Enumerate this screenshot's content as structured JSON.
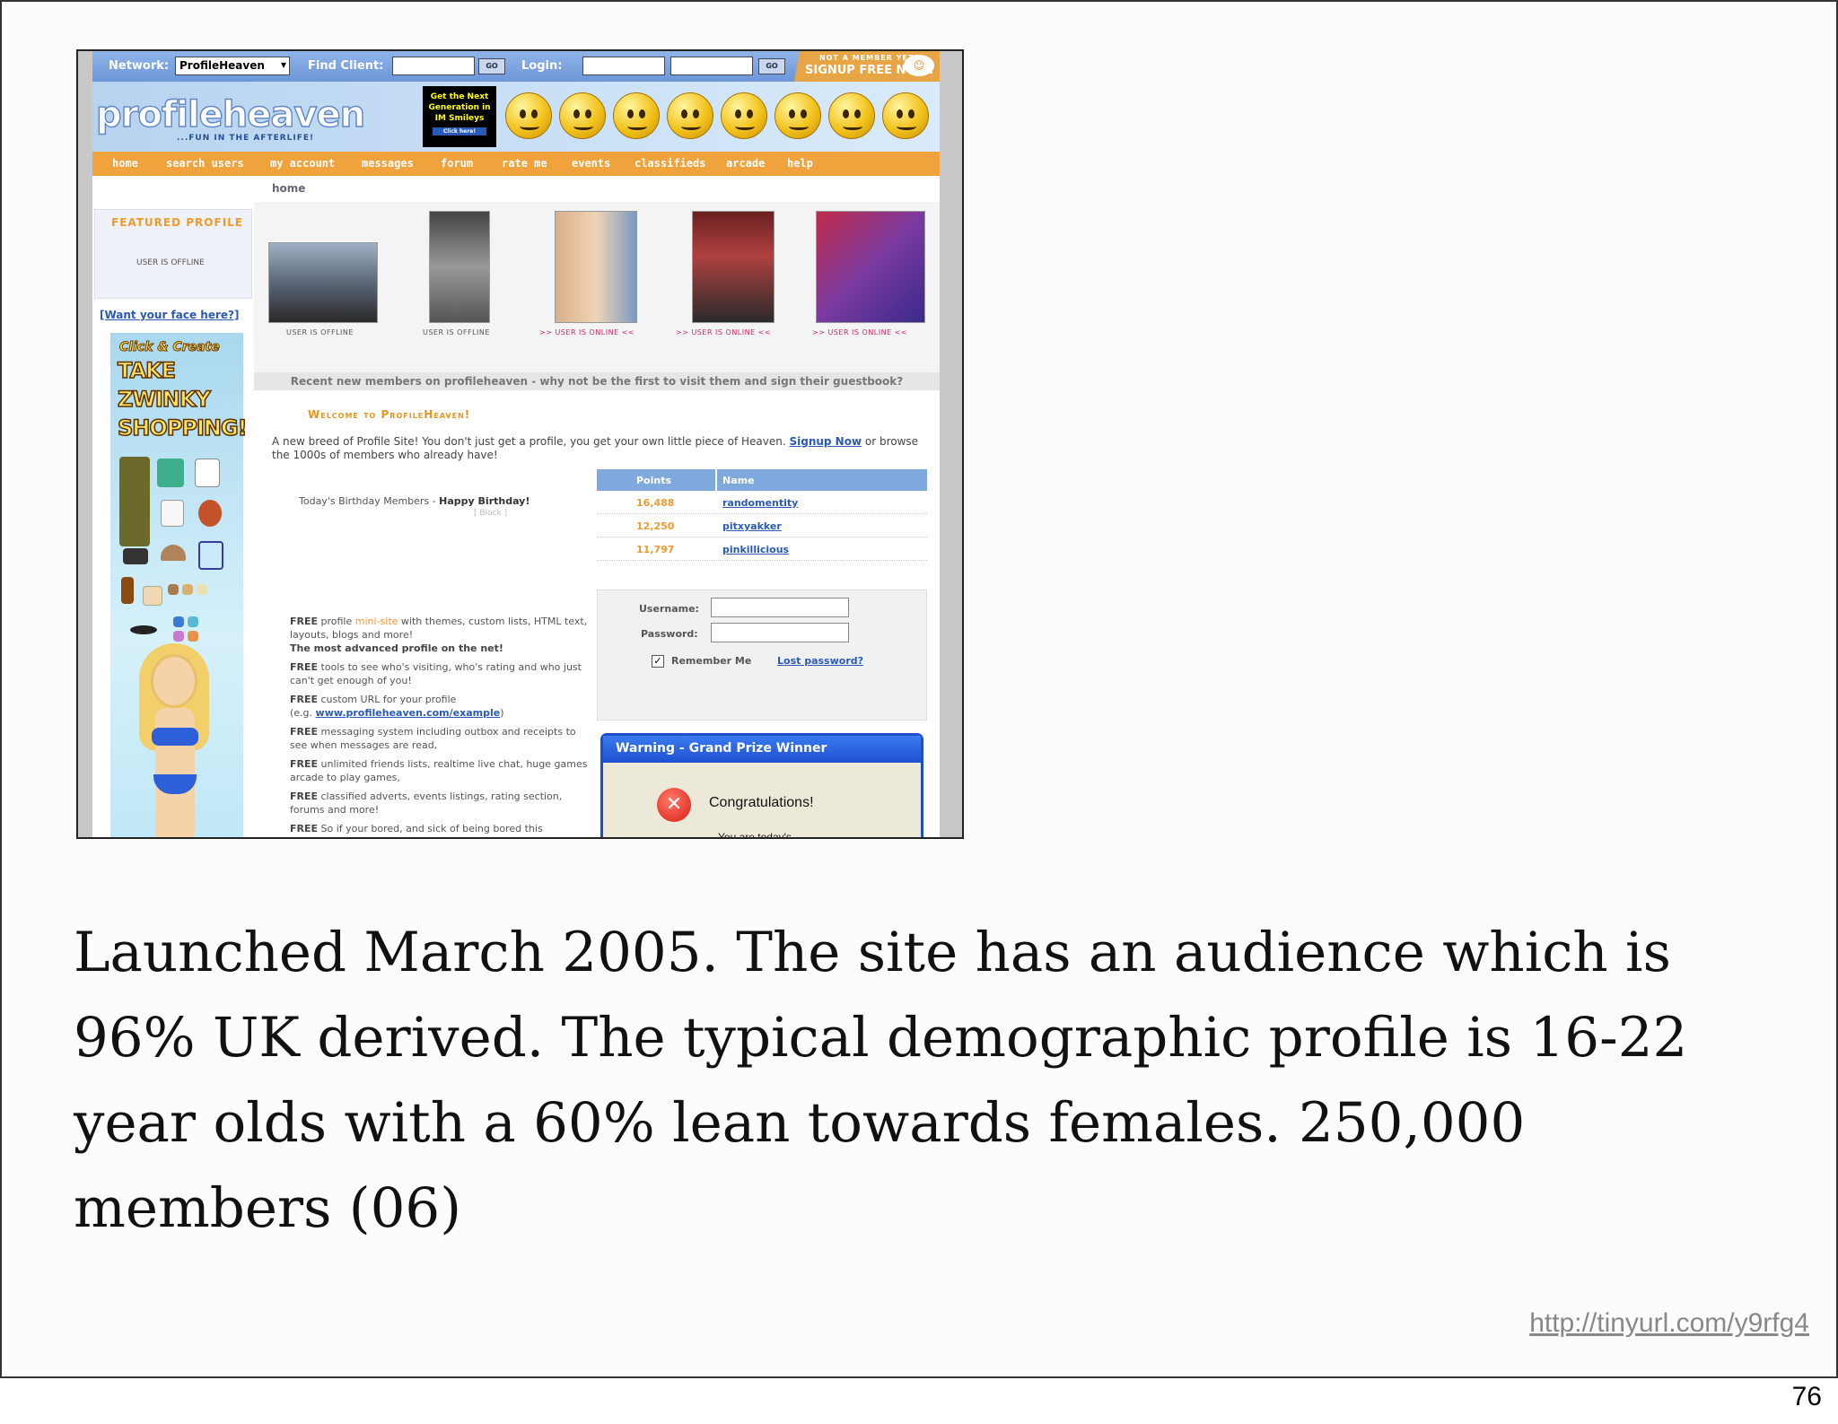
{
  "slide": {
    "page_number": "76",
    "caption": "Launched March 2005. The site has an audience which is 96% UK derived. The typical demographic profile is 16-22 year olds with a 60% lean towards females. 250,000 members (06)",
    "url": "http://tinyurl.com/y9rfg4"
  },
  "site": {
    "netbar": {
      "network_label": "Network:",
      "network_value": "ProfileHeaven",
      "find_client_label": "Find Client:",
      "go_label": "GO",
      "login_label": "Login:",
      "signup_small": "NOT A MEMBER YET?",
      "signup_big": "SIGNUP FREE NOW!"
    },
    "logo": "profileheaven",
    "tagline": "...FUN IN THE AFTERLIFE!",
    "ad_text": "Get the Next Generation in IM Smileys",
    "ad_click": "Click here!",
    "menu": [
      "home",
      "search users",
      "my account",
      "messages",
      "forum",
      "rate me",
      "events",
      "classifieds",
      "arcade",
      "help"
    ],
    "breadcrumb": "home",
    "featured": {
      "title": "FEATURED PROFILE",
      "status": "USER IS OFFLINE",
      "want_face": "[Want your face here?]"
    },
    "zwinky": {
      "click": "Click & Create",
      "line1": "TAKE",
      "line2": "ZWINKY",
      "line3": "SHOPPING!"
    },
    "profiles": [
      {
        "status": "USER IS OFFLINE",
        "online": false
      },
      {
        "status": "USER IS OFFLINE",
        "online": false
      },
      {
        "status": ">>  USER IS ONLINE  <<",
        "online": true
      },
      {
        "status": ">>  USER IS ONLINE  <<",
        "online": true
      },
      {
        "status": ">>  USER IS ONLINE  <<",
        "online": true
      }
    ],
    "recent_bar": "Recent new members on profileheaven - why not be the first to visit them and sign their guestbook?",
    "welcome": "Welcome to ProfileHeaven!",
    "intro_before": "A new breed of Profile Site! You don't just get a profile, you get your own little piece of Heaven. ",
    "intro_link": "Signup Now",
    "intro_after": " or browse the 1000s of members who already have!",
    "birthday_text": "Today's Birthday Members - ",
    "birthday_bold": "Happy Birthday!",
    "birthday_block": "[ Block ]",
    "points_table": {
      "headers": [
        "Points",
        "Name"
      ],
      "rows": [
        {
          "points": "16,488",
          "name": "randomentity"
        },
        {
          "points": "12,250",
          "name": "pitxyakker"
        },
        {
          "points": "11,797",
          "name": "pinkillicious"
        }
      ]
    },
    "login_form": {
      "username_label": "Username:",
      "password_label": "Password:",
      "remember_label": "Remember Me",
      "lost_password": "Lost password?"
    },
    "features": {
      "f1_bold": "FREE",
      "f1_a": " profile ",
      "f1_mini": "mini-site",
      "f1_b": " with themes, custom lists, HTML text, layouts, blogs and more!",
      "f1_line2": "The most advanced profile on the net!",
      "f2": " tools to see who's visiting, who's rating and who just can't get enough of you!",
      "f3": " custom URL for your profile",
      "f3_eg_a": "(e.g. ",
      "f3_link": "www.profileheaven.com/example",
      "f3_eg_b": ")",
      "f4": " messaging system including outbox and receipts to see when messages are read,",
      "f5": " unlimited friends lists, realtime live chat, huge games arcade to play games,",
      "f6": " classified adverts, events listings, rating section, forums and more!",
      "f7": " So if your bored, and sick of being bored this"
    },
    "dialog": {
      "title": "Warning - Grand Prize Winner",
      "message": "Congratulations!",
      "more": "You are today's"
    },
    "colors": {
      "menu_orange": "#f0a23c",
      "link_blue": "#2a5ab8",
      "online_pink": "#d2266c",
      "xp_title_blue": "#1e4fd0"
    }
  }
}
